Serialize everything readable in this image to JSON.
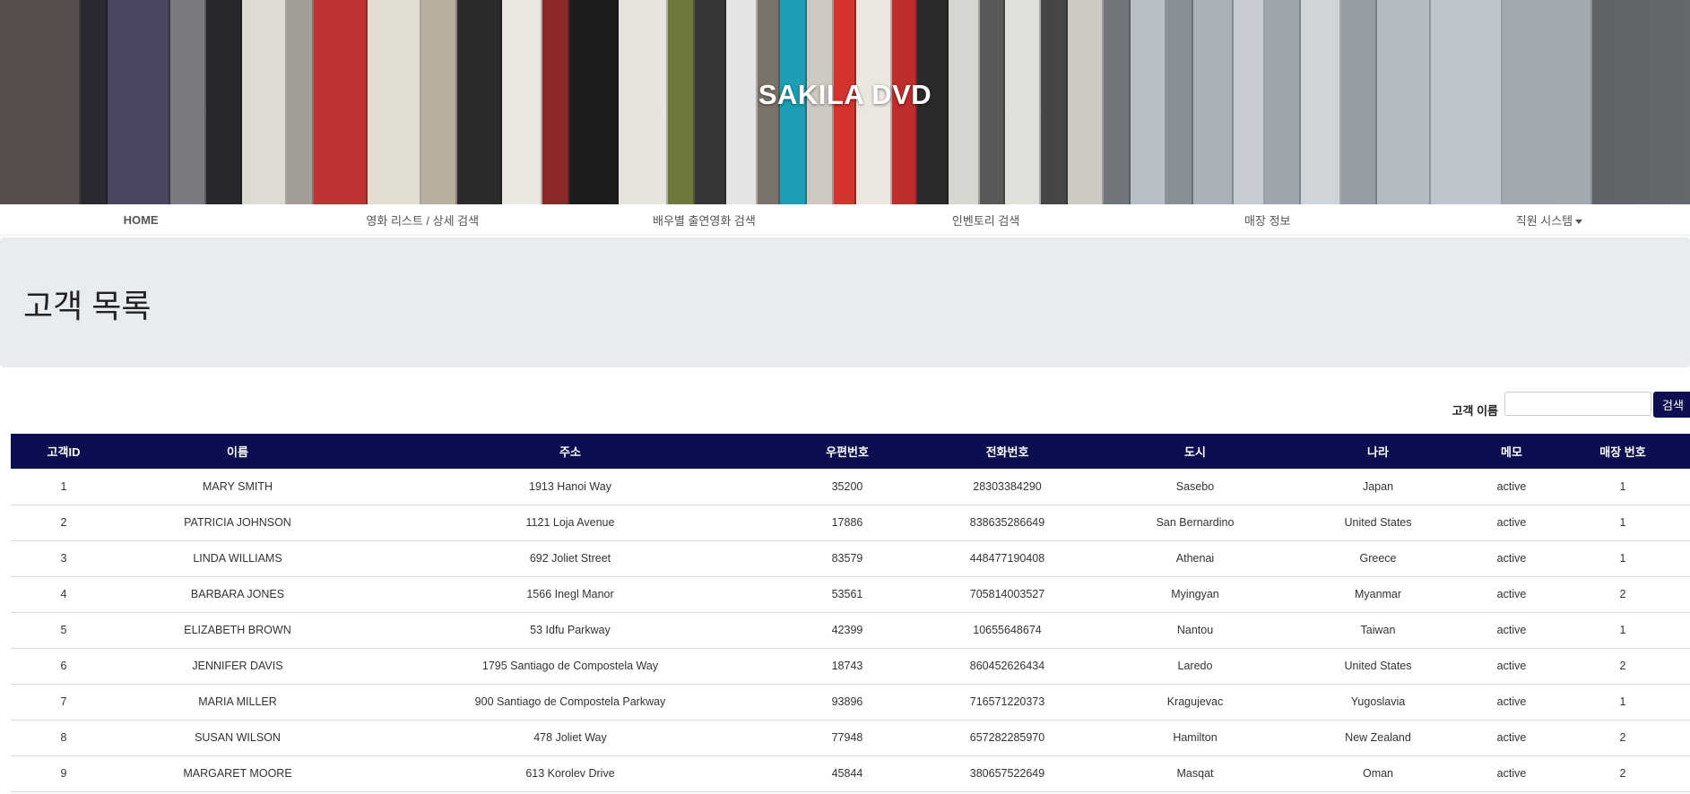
{
  "banner": {
    "title": "SAKILA DVD"
  },
  "nav": {
    "items": [
      {
        "label": "HOME"
      },
      {
        "label": "영화 리스트 / 상세 검색"
      },
      {
        "label": "배우별 출연영화 검색"
      },
      {
        "label": "인벤토리 검색"
      },
      {
        "label": "매장 정보"
      },
      {
        "label": "직원 시스템"
      }
    ]
  },
  "page": {
    "title": "고객 목록"
  },
  "search": {
    "label": "고객 이름",
    "value": "",
    "button_label": "검색"
  },
  "table": {
    "columns": [
      "고객ID",
      "이름",
      "주소",
      "우편번호",
      "전화번호",
      "도시",
      "나라",
      "메모",
      "매장 번호"
    ],
    "rows": [
      [
        "1",
        "MARY SMITH",
        "1913 Hanoi Way",
        "35200",
        "28303384290",
        "Sasebo",
        "Japan",
        "active",
        "1"
      ],
      [
        "2",
        "PATRICIA JOHNSON",
        "1121 Loja Avenue",
        "17886",
        "838635286649",
        "San Bernardino",
        "United States",
        "active",
        "1"
      ],
      [
        "3",
        "LINDA WILLIAMS",
        "692 Joliet Street",
        "83579",
        "448477190408",
        "Athenai",
        "Greece",
        "active",
        "1"
      ],
      [
        "4",
        "BARBARA JONES",
        "1566 Inegl Manor",
        "53561",
        "705814003527",
        "Myingyan",
        "Myanmar",
        "active",
        "2"
      ],
      [
        "5",
        "ELIZABETH BROWN",
        "53 Idfu Parkway",
        "42399",
        "10655648674",
        "Nantou",
        "Taiwan",
        "active",
        "1"
      ],
      [
        "6",
        "JENNIFER DAVIS",
        "1795 Santiago de Compostela Way",
        "18743",
        "860452626434",
        "Laredo",
        "United States",
        "active",
        "2"
      ],
      [
        "7",
        "MARIA MILLER",
        "900 Santiago de Compostela Parkway",
        "93896",
        "716571220373",
        "Kragujevac",
        "Yugoslavia",
        "active",
        "1"
      ],
      [
        "8",
        "SUSAN WILSON",
        "478 Joliet Way",
        "77948",
        "657282285970",
        "Hamilton",
        "New Zealand",
        "active",
        "2"
      ],
      [
        "9",
        "MARGARET MOORE",
        "613 Korolev Drive",
        "45844",
        "380657522649",
        "Masqat",
        "Oman",
        "active",
        "2"
      ]
    ]
  },
  "colors": {
    "header_bg": "#0b0e4f",
    "jumbotron_bg": "#e9ecef"
  }
}
